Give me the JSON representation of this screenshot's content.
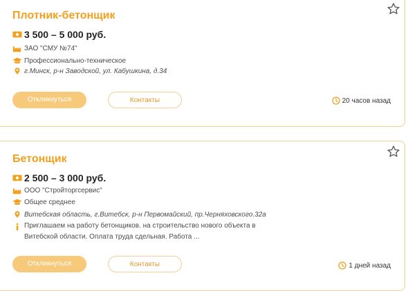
{
  "vacancies": [
    {
      "title": "Плотник-бетонщик",
      "salary": "3 500 – 5 000 руб.",
      "company": "ЗАО \"СМУ №74\"",
      "education": "Профессионально-техническое",
      "address": "г.Минск, р-н Заводской, ул. Кабушкина, д.34",
      "description": "",
      "respond_label": "Откликнуться",
      "contacts_label": "Контакты",
      "posted": "20 часов назад"
    },
    {
      "title": "Бетонщик",
      "salary": "2 500 – 3 000 руб.",
      "company": "ООО \"Стройторгсервис\"",
      "education": "Общее среднее",
      "address": "Витебская область, г.Витебск, р-н Первомайский, пр.Черняховского.32а",
      "description": "Приглашаем на работу бетонщиков. на строительство нового объекта в Витебской области. Оплата труда сдельная. Работа ...",
      "respond_label": "Откликнуться",
      "contacts_label": "Контакты",
      "posted": "1 дней назад"
    }
  ],
  "colors": {
    "accent": "#f2a01f",
    "button_fill": "#f7ca7b",
    "border": "#f2cf92"
  },
  "icons": [
    "star-icon",
    "money-icon",
    "factory-icon",
    "education-icon",
    "location-icon",
    "info-icon",
    "clock-icon"
  ]
}
